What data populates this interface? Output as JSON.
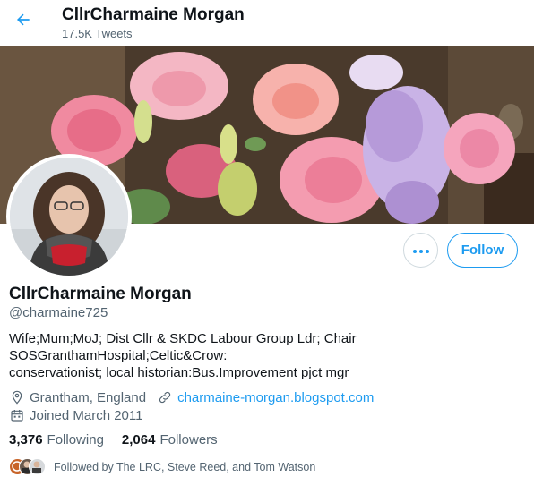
{
  "header": {
    "name": "CllrCharmaine Morgan",
    "tweet_count": "17.5K Tweets"
  },
  "actions": {
    "follow_label": "Follow"
  },
  "profile": {
    "display_name": "CllrCharmaine Morgan",
    "handle": "@charmaine725",
    "bio_lines": [
      "Wife;Mum;MoJ; Dist Cllr & SKDC Labour Group Ldr; Chair",
      "SOSGranthamHospital;Celtic&Crow:",
      "conservationist; local historian:Bus.Improvement pjct mgr"
    ],
    "location": "Grantham, England",
    "website": "charmaine-morgan.blogspot.com",
    "joined": "Joined March 2011"
  },
  "stats": {
    "following_count": "3,376",
    "following_label": "Following",
    "followers_count": "2,064",
    "followers_label": "Followers"
  },
  "followed_by": "Followed by The LRC, Steve Reed, and Tom Watson",
  "colors": {
    "accent": "#1d9bf0",
    "secondary_text": "#536471",
    "primary_text": "#0f1419",
    "border": "#cfd9de"
  }
}
